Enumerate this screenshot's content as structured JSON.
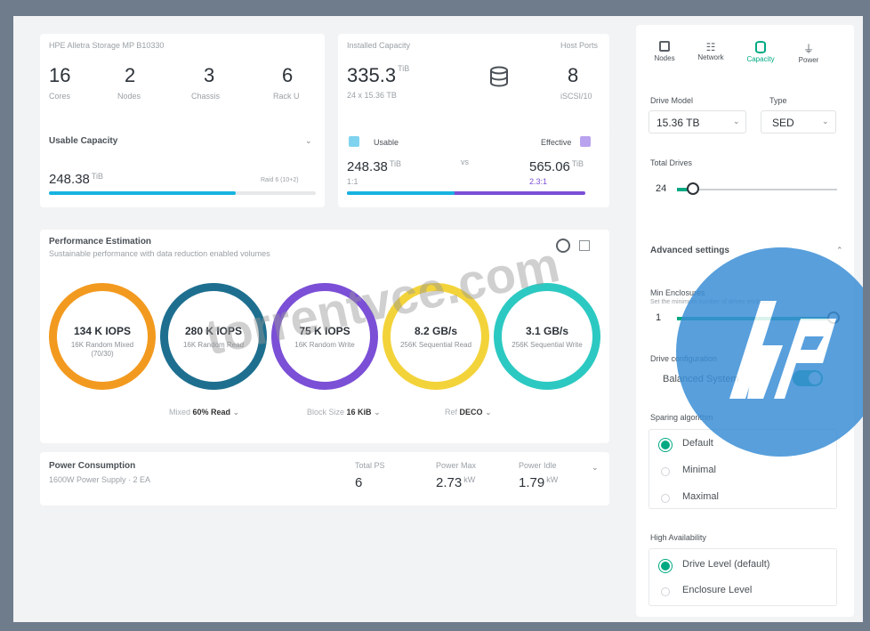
{
  "system": {
    "name": "HPE Alletra Storage MP B10330",
    "stats": [
      {
        "value": "16",
        "label": "Cores"
      },
      {
        "value": "2",
        "label": "Nodes"
      },
      {
        "value": "3",
        "label": "Chassis"
      },
      {
        "value": "6",
        "label": "Rack U"
      }
    ]
  },
  "installed": {
    "label": "Installed Capacity",
    "value": "335.3",
    "unit": "TiB",
    "sub": "24 x 15.36 TB",
    "host_ports_label": "Host Ports",
    "host_ports_value": "8",
    "host_ports_sub": "iSCSI/10"
  },
  "usable": {
    "label": "Usable Capacity",
    "value": "248.38",
    "unit": "TiB",
    "note": "Raid 6 (10+2)",
    "bar_fraction": 0.7
  },
  "effective": {
    "usable_label": "Usable",
    "usable_value": "248.38",
    "usable_unit": "TiB",
    "usable_sub": "1:1",
    "vs": "vs",
    "effective_label": "Effective",
    "effective_value": "565.06",
    "effective_unit": "TiB",
    "effective_sub": "2.3:1",
    "usable_fraction": 0.45
  },
  "performance": {
    "title": "Performance Estimation",
    "subtitle": "Sustainable performance with data reduction enabled volumes",
    "rings": [
      {
        "value": "134 K IOPS",
        "desc": "16K Random Mixed (70/30)",
        "color": "#f29a1f"
      },
      {
        "value": "280 K IOPS",
        "desc": "16K Random Read",
        "color": "#1e6f8f"
      },
      {
        "value": "75 K IOPS",
        "desc": "16K Random Write",
        "color": "#7b4fd6"
      },
      {
        "value": "8.2 GB/s",
        "desc": "256K Sequential Read",
        "color": "#f3d33a"
      },
      {
        "value": "3.1 GB/s",
        "desc": "256K Sequential Write",
        "color": "#2cc9c2"
      }
    ],
    "filters": [
      {
        "label": "Mixed",
        "value": "60% Read"
      },
      {
        "value": "16 KiB",
        "label": "Block Size"
      },
      {
        "label": "Ref",
        "value": "DECO"
      }
    ]
  },
  "power": {
    "title": "Power Consumption",
    "subtitle": "1600W Power Supply · 2 EA",
    "total_label": "Total PS",
    "total_value": "6",
    "max_label": "Power Max",
    "max_value": "2.73",
    "max_unit": "kW",
    "idle_label": "Power Idle",
    "idle_value": "1.79",
    "idle_unit": "kW"
  },
  "tabs": [
    {
      "label": "Nodes",
      "icon": "node-icon"
    },
    {
      "label": "Network",
      "icon": "network-icon"
    },
    {
      "label": "Capacity",
      "icon": "database-icon",
      "active": true
    },
    {
      "label": "Power",
      "icon": "plug-icon"
    }
  ],
  "config": {
    "drive_model_label": "Drive Model",
    "drive_model_value": "15.36 TB",
    "type_label": "Type",
    "type_value": "SED",
    "total_drives_label": "Total Drives",
    "total_drives_value": "24",
    "total_drives_fraction": 0.1,
    "advanced_label": "Advanced settings",
    "min_ins_label": "Min Enclosures",
    "min_ins_desc": "Set the minimum number of drives enclosure",
    "min_ins_value": "1",
    "min_ins_fraction": 0.98,
    "drive_conf_label": "Drive configuration",
    "drive_conf_value": "Balanced System",
    "sparing_label": "Sparing algorithm",
    "sparing_options": [
      "Default",
      "Minimal",
      "Maximal"
    ],
    "ha_label": "High Availability",
    "ha_options": [
      "Drive Level (default)",
      "Enclosure Level"
    ]
  },
  "watermark": {
    "text": "torrentvce.com"
  },
  "colors": {
    "accent": "#01a982",
    "cyan": "#17b3e0",
    "purple": "#7b4fd6",
    "hp_blue": "#3b8fd6"
  }
}
